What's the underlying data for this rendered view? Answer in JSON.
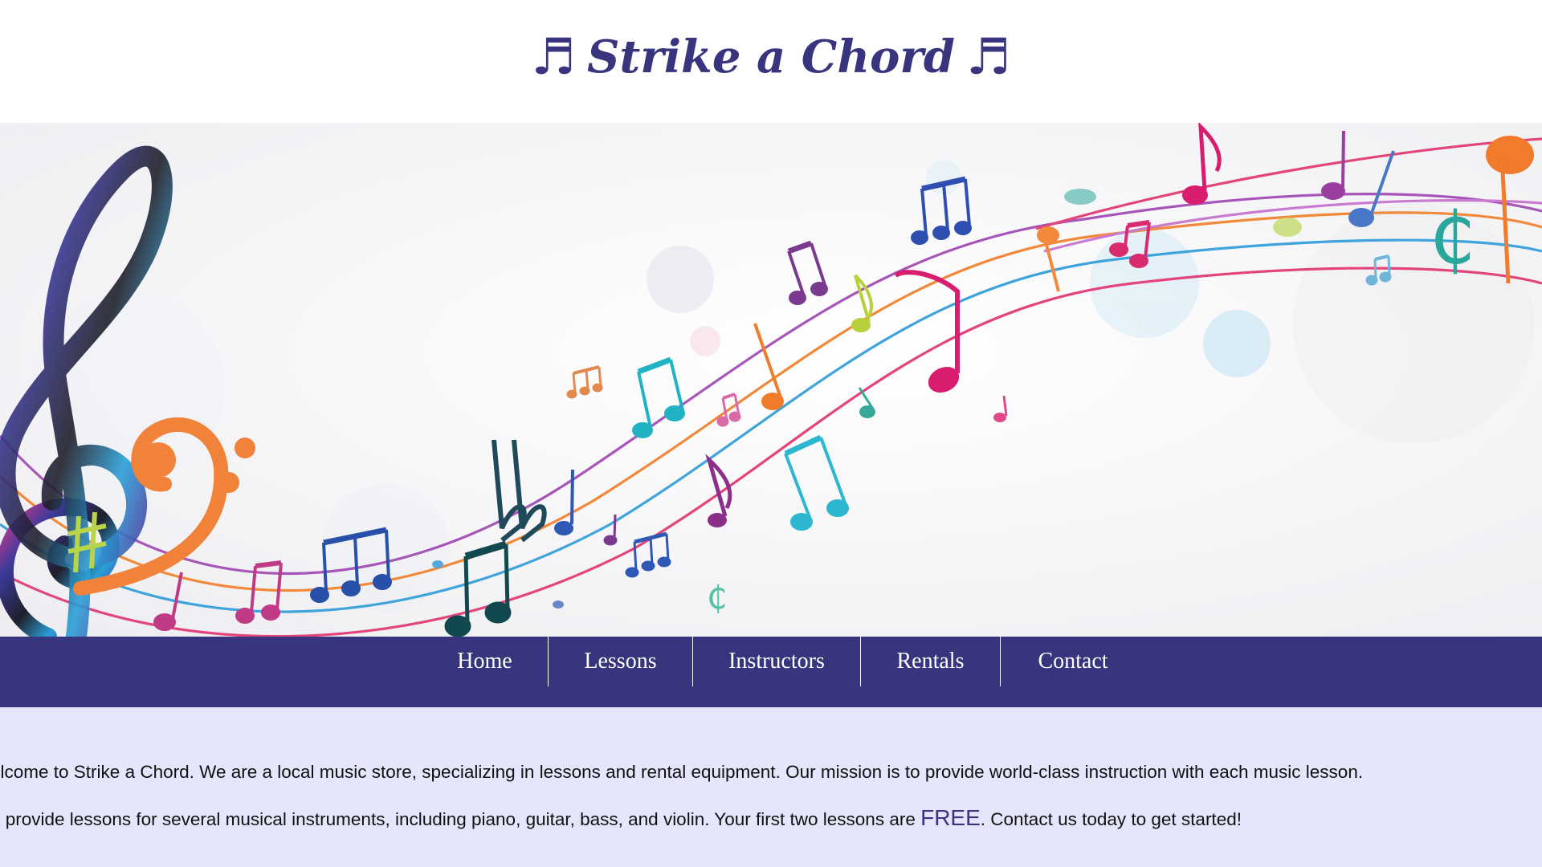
{
  "header": {
    "title": "Strike a Chord",
    "note_icon": "♬"
  },
  "nav": {
    "items": [
      {
        "label": "Home"
      },
      {
        "label": "Lessons"
      },
      {
        "label": "Instructors"
      },
      {
        "label": "Rentals"
      },
      {
        "label": "Contact"
      }
    ]
  },
  "content": {
    "paragraph1": "elcome to Strike a Chord. We are a local music store, specializing in lessons and rental equipment. Our mission is to provide world-class instruction with each music lesson.",
    "paragraph2_before": "e provide lessons for several musical instruments, including piano, guitar, bass, and violin. Your first two lessons are ",
    "paragraph2_highlight": "FREE",
    "paragraph2_after": ". Contact us today to get started!"
  },
  "colors": {
    "brand": "#38347e",
    "nav_background": "#38357f",
    "content_background": "#e5e6fb",
    "hero_background": "#fbfbfc"
  },
  "hero_icons": [
    "treble-clef-icon",
    "bass-clef-icon",
    "sharp-icon",
    "flat-icon",
    "cut-time-icon",
    "music-note-icon",
    "beamed-notes-icon"
  ]
}
